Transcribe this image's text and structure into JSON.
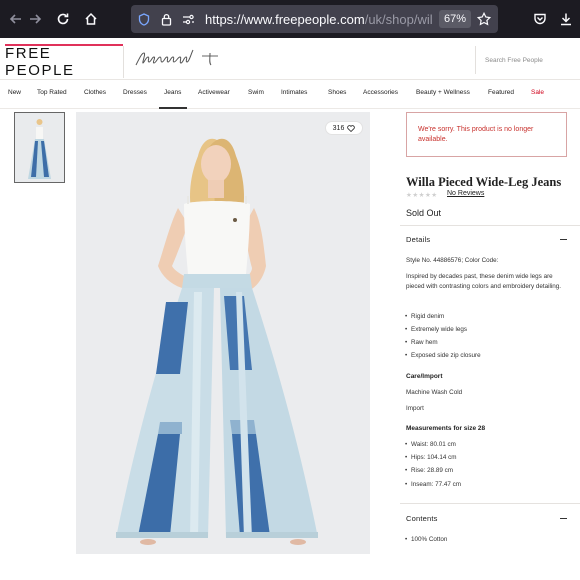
{
  "browser": {
    "url_host": "https://www.freepeople.com",
    "url_path": "/uk/shop/willa-p",
    "zoom": "67%",
    "icons": [
      "back-arrow-icon",
      "forward-arrow-icon",
      "reload-icon",
      "home-icon",
      "tracking-shield-icon",
      "lock-icon",
      "permissions-icon",
      "bookmark-star-icon",
      "pocket-icon",
      "download-icon"
    ]
  },
  "header": {
    "logo": "FREE PEOPLE",
    "sub_logo": "fpmovement",
    "search_placeholder": "Search Free People",
    "accent_color": "#e0315a"
  },
  "nav": {
    "items": [
      "New",
      "Top Rated",
      "Clothes",
      "Dresses",
      "Jeans",
      "Activewear",
      "Swim",
      "Intimates",
      "Shoes",
      "Accessories",
      "Beauty + Wellness",
      "Featured",
      "Sale"
    ],
    "active": "Jeans",
    "sale_color": "#d0021b"
  },
  "gallery": {
    "fav_count": "316"
  },
  "product": {
    "unavailable_message": "We're sorry. This product is no longer available.",
    "title": "Willa Pieced Wide-Leg Jeans",
    "reviews_link": "No Reviews",
    "rating_stars": 0,
    "status": "Sold Out"
  },
  "details": {
    "heading": "Details",
    "style_line": "Style No. 44886576; Color Code:",
    "description": "Inspired by decades past, these denim wide legs are pieced with contrasting colors and embroidery detailing.",
    "bullets": [
      "Rigid denim",
      "Extremely wide legs",
      "Raw hem",
      "Exposed side zip closure"
    ],
    "care_heading": "Care/Import",
    "care_line": "Machine Wash Cold",
    "import_line": "Import",
    "measure_heading": "Measurements for size 28",
    "measurements": [
      "Waist: 80.01 cm",
      "Hips: 104.14 cm",
      "Rise: 28.89 cm",
      "Inseam: 77.47 cm"
    ]
  },
  "contents": {
    "heading": "Contents",
    "items": [
      "100% Cotton"
    ]
  }
}
